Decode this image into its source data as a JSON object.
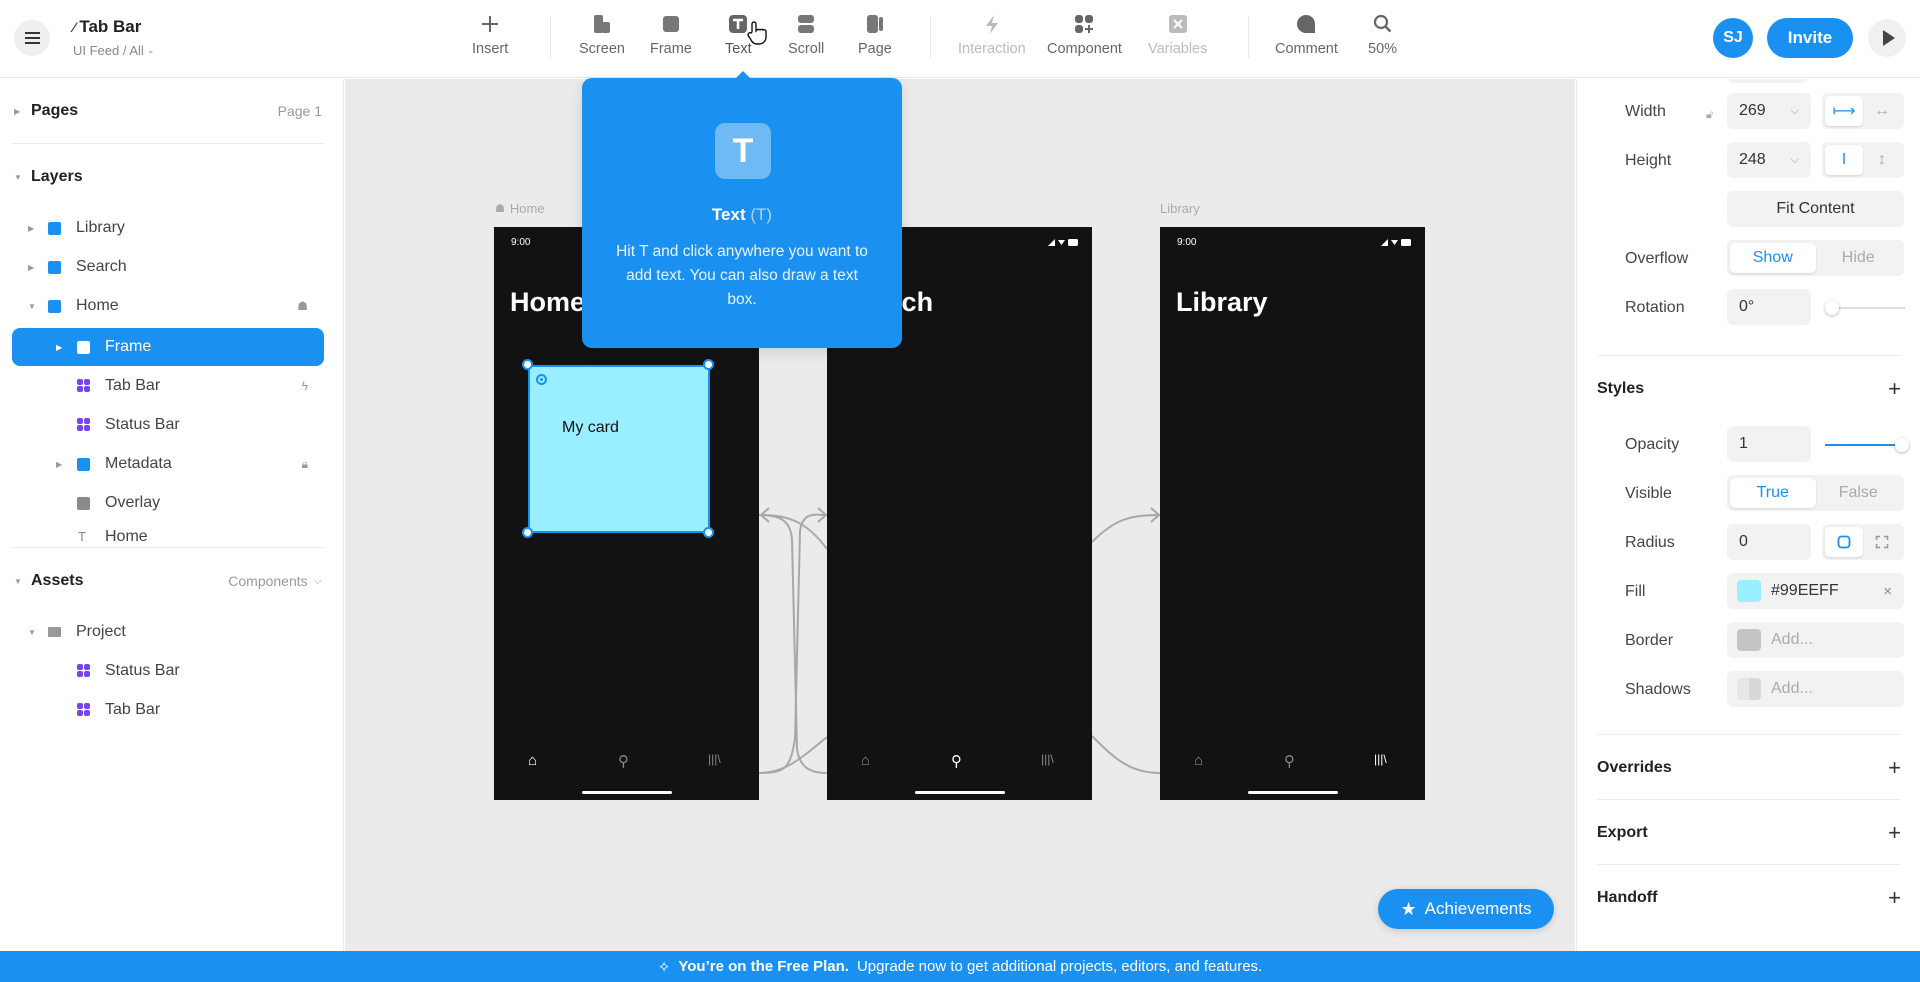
{
  "header": {
    "doc_title": "Tab Bar",
    "breadcrumb": "UI Feed / All",
    "avatar_initials": "SJ",
    "invite_label": "Invite"
  },
  "toolbar": [
    {
      "id": "insert",
      "label": "Insert",
      "icon": "plus-icon",
      "disabled": false
    },
    {
      "id": "screen",
      "label": "Screen",
      "icon": "screen-icon",
      "disabled": false
    },
    {
      "id": "frame",
      "label": "Frame",
      "icon": "frame-icon",
      "disabled": false
    },
    {
      "id": "text",
      "label": "Text",
      "icon": "text-icon",
      "disabled": false,
      "active": true
    },
    {
      "id": "scroll",
      "label": "Scroll",
      "icon": "scroll-icon",
      "disabled": false
    },
    {
      "id": "page",
      "label": "Page",
      "icon": "page-icon",
      "disabled": false
    },
    {
      "id": "interaction",
      "label": "Interaction",
      "icon": "lightning-icon",
      "disabled": true
    },
    {
      "id": "component",
      "label": "Component",
      "icon": "component-icon",
      "disabled": false
    },
    {
      "id": "variables",
      "label": "Variables",
      "icon": "variables-icon",
      "disabled": true
    },
    {
      "id": "comment",
      "label": "Comment",
      "icon": "comment-icon",
      "disabled": false
    },
    {
      "id": "zoom",
      "label": "50%",
      "icon": "magnifier-icon",
      "disabled": false
    }
  ],
  "sidebar": {
    "pages": {
      "title": "Pages",
      "current": "Page 1"
    },
    "layers": {
      "title": "Layers",
      "items": [
        {
          "label": "Library",
          "kind": "screen",
          "color": "#1a91f0",
          "depth": 0,
          "expandable": true
        },
        {
          "label": "Search",
          "kind": "screen",
          "color": "#1a91f0",
          "depth": 0,
          "expandable": true
        },
        {
          "label": "Home",
          "kind": "screen",
          "color": "#1a91f0",
          "depth": 0,
          "expandable": true,
          "expanded": true,
          "right_icon": "home-icon"
        },
        {
          "label": "Frame",
          "kind": "frame",
          "color": "#ffffff",
          "depth": 1,
          "expandable": true,
          "selected": true
        },
        {
          "label": "Tab Bar",
          "kind": "component",
          "depth": 1,
          "right_icon": "lightning-icon"
        },
        {
          "label": "Status Bar",
          "kind": "component",
          "depth": 1
        },
        {
          "label": "Metadata",
          "kind": "frame",
          "color": "#1a91f0",
          "depth": 1,
          "expandable": true,
          "right_icon": "lock-icon"
        },
        {
          "label": "Overlay",
          "kind": "frame",
          "color": "#8a8a8a",
          "depth": 1
        },
        {
          "label": "Home",
          "kind": "text",
          "depth": 1
        }
      ]
    },
    "assets": {
      "title": "Assets",
      "filter": "Components",
      "folder": "Project",
      "items": [
        "Status Bar",
        "Tab Bar"
      ]
    }
  },
  "canvas": {
    "screens": [
      {
        "label": "Home",
        "time": "9:00",
        "heading": "Home",
        "active_tab": 0
      },
      {
        "label": "",
        "time": "",
        "heading": "Search",
        "active_tab": 1
      },
      {
        "label": "Library",
        "time": "9:00",
        "heading": "Library",
        "active_tab": 2
      }
    ],
    "tab_glyphs": [
      "⌂",
      "⚲",
      "|||\\"
    ],
    "card": {
      "label": "My card",
      "fill": "#99EEFF"
    },
    "home_label_icon": "home-icon"
  },
  "tooltip": {
    "title": "Text",
    "shortcut": "(T)",
    "description": "Hit T and click anywhere you want to add text. You can also draw a text box."
  },
  "achievements_label": "Achievements",
  "properties": {
    "width": {
      "label": "Width",
      "value": "269"
    },
    "height": {
      "label": "Height",
      "value": "248"
    },
    "fit_content": "Fit Content",
    "overflow": {
      "label": "Overflow",
      "options": [
        "Show",
        "Hide"
      ],
      "selected": "Show"
    },
    "rotation": {
      "label": "Rotation",
      "value": "0°",
      "slider_fraction": 0
    },
    "styles": {
      "title": "Styles",
      "opacity": {
        "label": "Opacity",
        "value": "1",
        "slider_fraction": 1
      },
      "visible": {
        "label": "Visible",
        "options": [
          "True",
          "False"
        ],
        "selected": "True"
      },
      "radius": {
        "label": "Radius",
        "value": "0"
      },
      "fill": {
        "label": "Fill",
        "value": "#99EEFF",
        "color": "#99eeff"
      },
      "border": {
        "label": "Border",
        "placeholder": "Add..."
      },
      "shadows": {
        "label": "Shadows",
        "placeholder": "Add..."
      }
    },
    "sections": [
      "Overrides",
      "Export",
      "Handoff"
    ]
  },
  "banner": {
    "bold": "You’re on the Free Plan.",
    "text": "Upgrade now to get additional projects, editors, and features."
  },
  "colors": {
    "accent": "#1a91f0",
    "component": "#7a45e6",
    "screen_bg": "#121212",
    "canvas_bg": "#ebebeb"
  }
}
